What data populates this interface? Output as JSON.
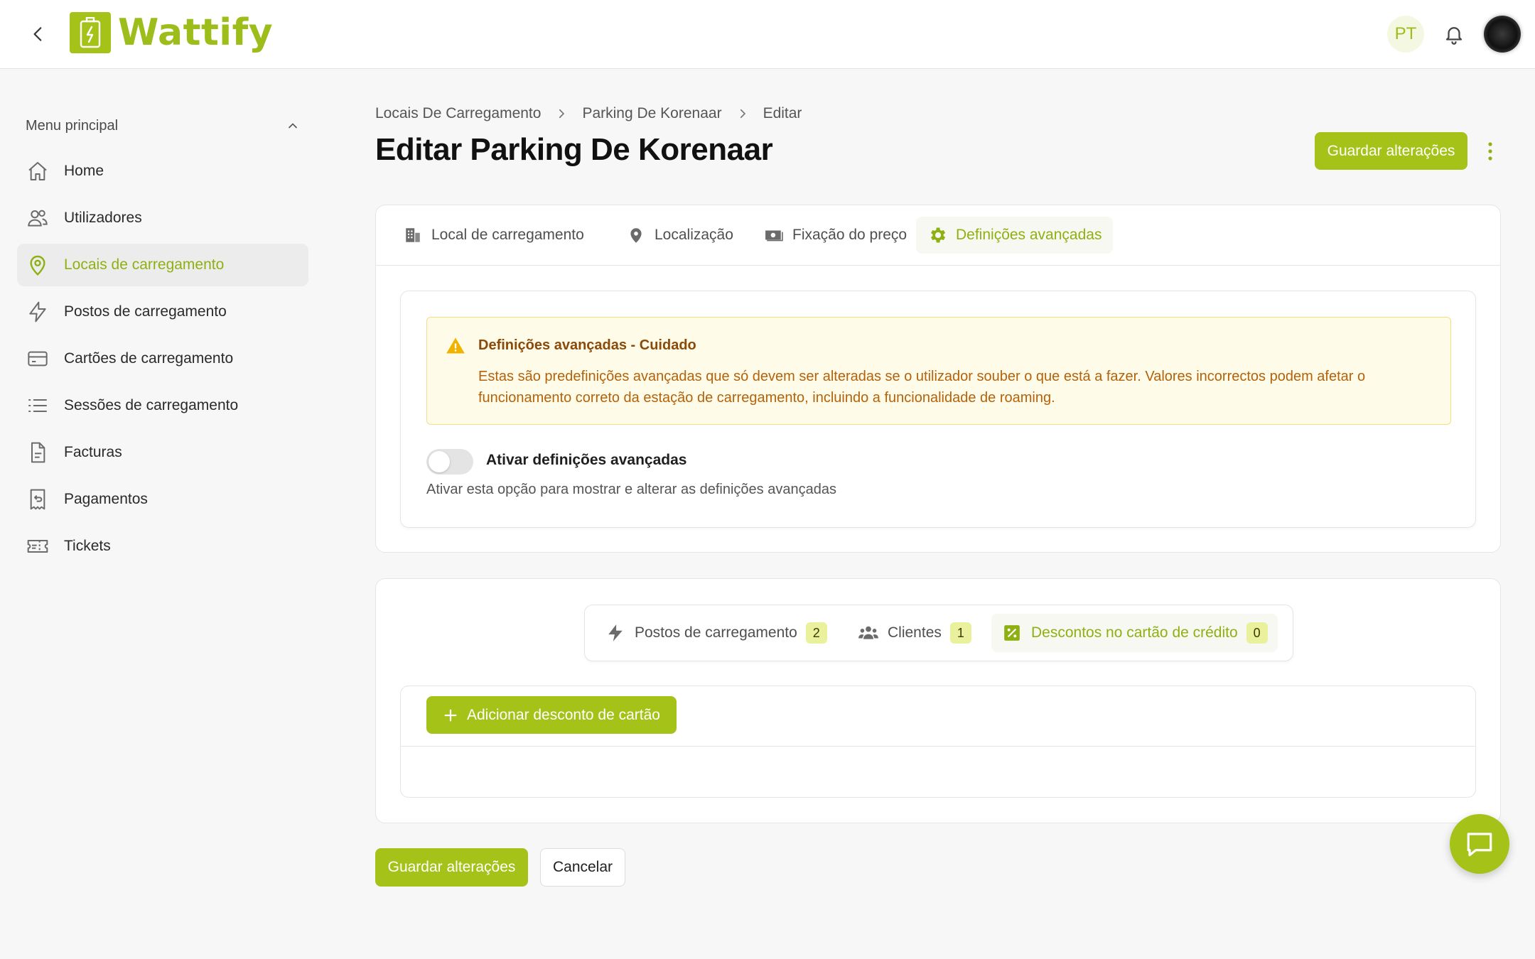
{
  "app": {
    "logo_text": "Wattify",
    "brand_color": "#a5c218"
  },
  "header": {
    "language": "PT"
  },
  "sidebar": {
    "menu_title": "Menu principal",
    "items": [
      {
        "label": "Home",
        "icon": "home-icon"
      },
      {
        "label": "Utilizadores",
        "icon": "users-icon"
      },
      {
        "label": "Locais de carregamento",
        "icon": "location-pin-icon",
        "active": true
      },
      {
        "label": "Postos de carregamento",
        "icon": "lightning-icon"
      },
      {
        "label": "Cartões de carregamento",
        "icon": "card-icon"
      },
      {
        "label": "Sessões de carregamento",
        "icon": "list-icon"
      },
      {
        "label": "Facturas",
        "icon": "document-icon"
      },
      {
        "label": "Pagamentos",
        "icon": "receipt-icon"
      },
      {
        "label": "Tickets",
        "icon": "ticket-icon"
      }
    ]
  },
  "breadcrumb": [
    "Locais De Carregamento",
    "Parking De Korenaar",
    "Editar"
  ],
  "page": {
    "title": "Editar Parking De Korenaar",
    "save_label": "Guardar alterações",
    "cancel_label": "Cancelar"
  },
  "tabs": [
    {
      "label": "Local de carregamento",
      "icon": "building-icon"
    },
    {
      "label": "Localização",
      "icon": "map-pin-icon"
    },
    {
      "label": "Fixação do preço",
      "icon": "money-icon"
    },
    {
      "label": "Definições avançadas",
      "icon": "gear-icon",
      "active": true
    }
  ],
  "advanced": {
    "warning_title": "Definições avançadas - Cuidado",
    "warning_text": "Estas são predefinições avançadas que só devem ser alteradas se o utilizador souber o que está a fazer. Valores incorrectos podem afetar o funcionamento correto da estação de carregamento, incluindo a funcionalidade de roaming.",
    "toggle_label": "Ativar definições avançadas",
    "toggle_on": false,
    "toggle_description": "Ativar esta opção para mostrar e alterar as definições avançadas"
  },
  "subtabs": [
    {
      "label": "Postos de carregamento",
      "count": "2",
      "icon": "lightning-icon"
    },
    {
      "label": "Clientes",
      "count": "1",
      "icon": "group-icon"
    },
    {
      "label": "Descontos no cartão de crédito",
      "count": "0",
      "icon": "discount-icon",
      "active": true
    }
  ],
  "discounts": {
    "add_label": "Adicionar desconto de cartão"
  }
}
